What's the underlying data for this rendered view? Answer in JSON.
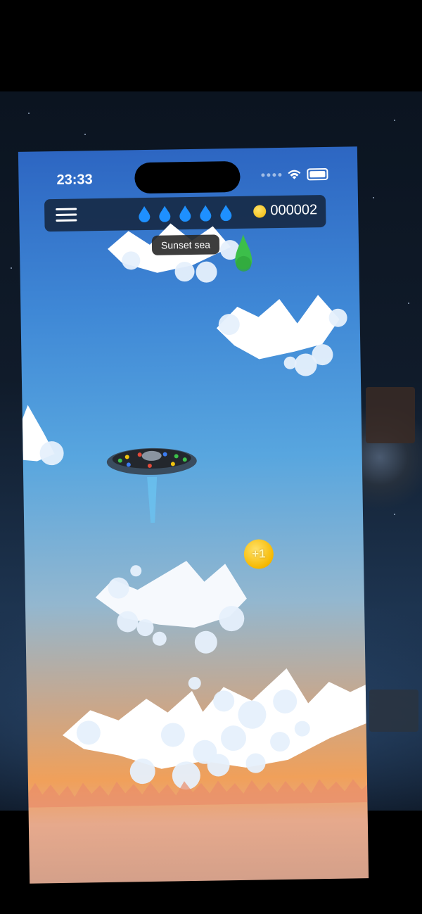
{
  "status_bar": {
    "time": "23:33"
  },
  "hud": {
    "menu_icon": "hamburger-menu-icon",
    "lives": [
      {
        "icon": "water-drop-icon",
        "color": "#1e90ff"
      },
      {
        "icon": "water-drop-icon",
        "color": "#1e90ff"
      },
      {
        "icon": "water-drop-icon",
        "color": "#1e90ff"
      },
      {
        "icon": "water-drop-icon",
        "color": "#1e90ff"
      },
      {
        "icon": "water-drop-icon",
        "color": "#1e90ff"
      }
    ],
    "coin_count": "000002"
  },
  "level_tooltip": "Sunset sea",
  "pickups": {
    "bonus_coin_label": "+1"
  },
  "colors": {
    "sky_top": "#2d66c2",
    "sky_bottom": "#f0a05a",
    "drop": "#1e90ff",
    "green_drop": "#3cbf4a",
    "coin": "#f6b800",
    "hud_bg": "#14243c"
  }
}
